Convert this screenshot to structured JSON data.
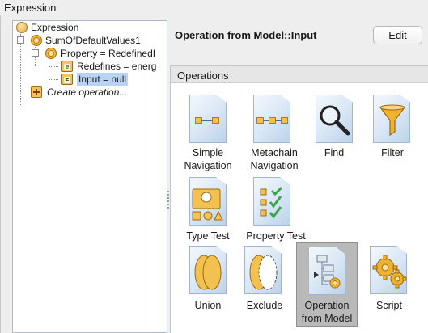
{
  "group": {
    "title": "Expression"
  },
  "tree": {
    "items": [
      {
        "label": "Expression",
        "icon": "expression-icon"
      },
      {
        "label": "SumOfDefaultValues1",
        "icon": "operation-sun-icon"
      },
      {
        "label": "Property = RedefinedI",
        "icon": "property-sun-icon"
      },
      {
        "label": "Redefines = energ",
        "icon": "parameter-box-icon",
        "badge": "e"
      },
      {
        "label": "Input = null",
        "icon": "input-box-icon",
        "badge": "≠",
        "selected": true
      },
      {
        "label": "Create operation...",
        "icon": "create-plus-icon"
      }
    ]
  },
  "panel": {
    "title": "Operation from Model::Input",
    "edit_label": "Edit"
  },
  "operations": {
    "title": "Operations",
    "items": [
      {
        "line1": "Simple",
        "line2": "Navigation",
        "icon": "simple-navigation-icon"
      },
      {
        "line1": "Metachain",
        "line2": "Navigation",
        "icon": "metachain-navigation-icon"
      },
      {
        "line1": "Find",
        "line2": "",
        "icon": "find-magnifier-icon"
      },
      {
        "line1": "Filter",
        "line2": "",
        "icon": "filter-funnel-icon"
      },
      {
        "line1": "Type Test",
        "line2": "",
        "icon": "type-test-icon"
      },
      {
        "line1": "Property Test",
        "line2": "",
        "icon": "property-test-icon"
      },
      {
        "line1": "Union",
        "line2": "",
        "icon": "union-icon"
      },
      {
        "line1": "Exclude",
        "line2": "",
        "icon": "exclude-icon"
      },
      {
        "line1": "Operation",
        "line2": "from Model",
        "icon": "operation-from-model-icon",
        "selected": true
      },
      {
        "line1": "Script",
        "line2": "",
        "icon": "script-gears-icon"
      }
    ]
  },
  "colors": {
    "selection": "#b7d4f6",
    "tile_selected": "#b9b9b9",
    "accent_orange": "#f3c14f"
  }
}
